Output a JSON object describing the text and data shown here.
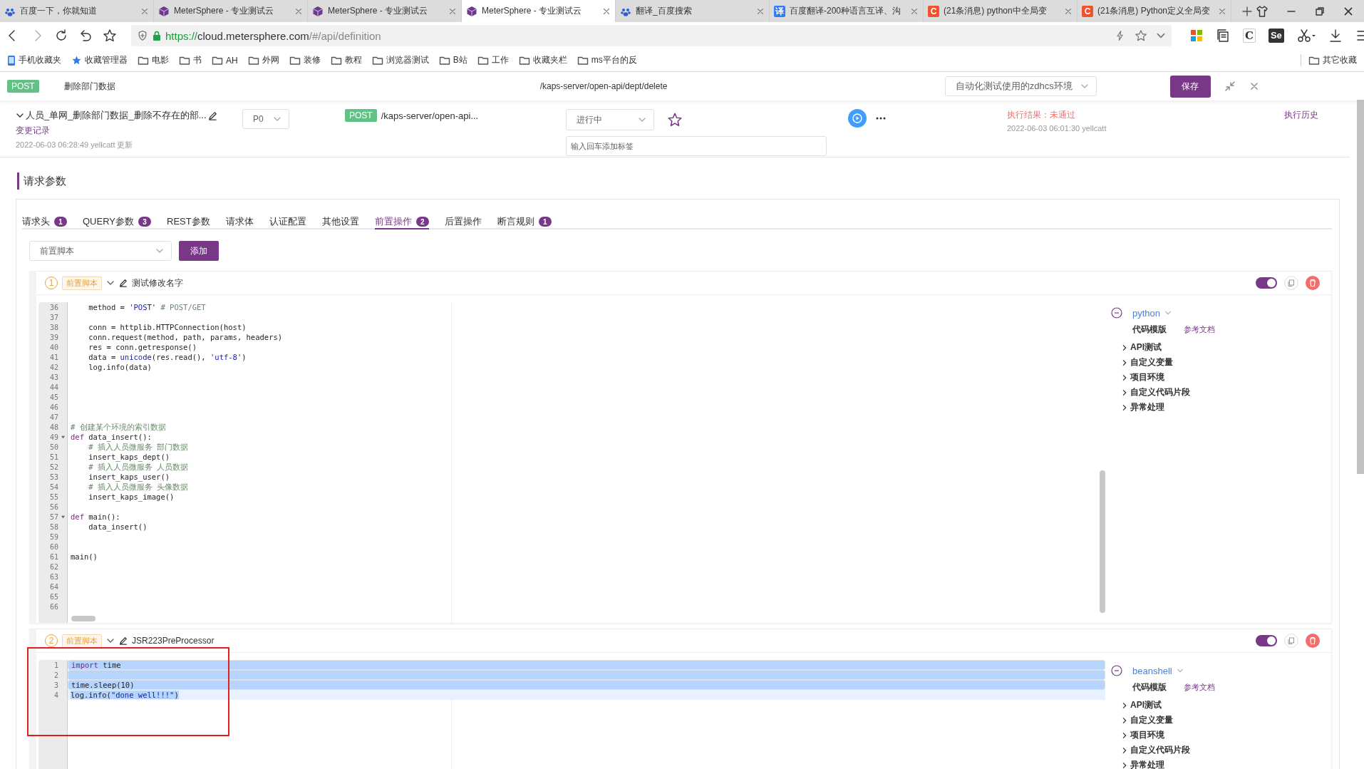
{
  "browser": {
    "tabs": [
      {
        "title": "百度一下，你就知道",
        "kind": "baidu",
        "selected": false
      },
      {
        "title": "MeterSphere - 专业测试云",
        "kind": "metersphere",
        "selected": false
      },
      {
        "title": "MeterSphere - 专业测试云",
        "kind": "metersphere",
        "selected": false
      },
      {
        "title": "MeterSphere - 专业测试云",
        "kind": "metersphere",
        "selected": true
      },
      {
        "title": "翻译_百度搜索",
        "kind": "baidu",
        "selected": false
      },
      {
        "title": "百度翻译-200种语言互译、沟",
        "kind": "badge",
        "badge": "译",
        "color": "#2e7cf6",
        "selected": false
      },
      {
        "title": "(21条消息) python中全局变",
        "kind": "badge",
        "badge": "C",
        "color": "#f0522d",
        "selected": false
      },
      {
        "title": "(21条消息) Python定义全局变",
        "kind": "badge",
        "badge": "C",
        "color": "#f0522d",
        "selected": false
      }
    ],
    "address": {
      "scheme": "https://",
      "host": "cloud.metersphere.com",
      "path": "/#/api/definition"
    },
    "extensions": [
      {
        "kind": "tiles"
      },
      {
        "kind": "reader"
      },
      {
        "kind": "letter",
        "text": "C"
      },
      {
        "kind": "dark-letter",
        "text": "Se"
      },
      {
        "kind": "scissors"
      },
      {
        "kind": "download"
      },
      {
        "kind": "menu"
      }
    ],
    "bookmarks": [
      {
        "label": "手机收藏夹",
        "kind": "phone"
      },
      {
        "label": "收藏管理器",
        "kind": "star"
      },
      {
        "label": "电影",
        "kind": "folder"
      },
      {
        "label": "书",
        "kind": "folder"
      },
      {
        "label": "AH",
        "kind": "folder"
      },
      {
        "label": "外网",
        "kind": "folder"
      },
      {
        "label": "装修",
        "kind": "folder"
      },
      {
        "label": "教程",
        "kind": "folder"
      },
      {
        "label": "浏览器测试",
        "kind": "folder"
      },
      {
        "label": "B站",
        "kind": "folder"
      },
      {
        "label": "工作",
        "kind": "folder"
      },
      {
        "label": "收藏夹栏",
        "kind": "folder"
      },
      {
        "label": "ms平台的反",
        "kind": "folder"
      }
    ],
    "other_bookmarks": "其它收藏"
  },
  "header": {
    "method": "POST",
    "name": "删除部门数据",
    "path": "/kaps-server/open-api/dept/delete",
    "environment": "自动化测试使用的zdhcs环境",
    "save": "保存"
  },
  "case": {
    "name": "人员_单网_删除部门数据_删除不存在的部...",
    "change_log": "变更记录",
    "updated": "2022-06-03 06:28:49 yellcatt 更新",
    "priority": "P0",
    "method": "POST",
    "path": "/kaps-server/open-api...",
    "status": "进行中",
    "tag_placeholder": "输入回车添加标签",
    "result": "执行结果：未通过",
    "result_time": "2022-06-03 06:01:30 yellcatt",
    "history": "执行历史"
  },
  "section_title": "请求参数",
  "param_tabs": [
    {
      "label": "请求头",
      "count": "1",
      "selected": false
    },
    {
      "label": "QUERY参数",
      "count": "3",
      "selected": false
    },
    {
      "label": "REST参数",
      "selected": false
    },
    {
      "label": "请求体",
      "selected": false
    },
    {
      "label": "认证配置",
      "selected": false
    },
    {
      "label": "其他设置",
      "selected": false
    },
    {
      "label": "前置操作",
      "count": "2",
      "selected": true
    },
    {
      "label": "后置操作",
      "selected": false
    },
    {
      "label": "断言规则",
      "count": "1",
      "selected": false
    }
  ],
  "processor_select": "前置脚本",
  "add_button": "添加",
  "processors": [
    {
      "index": "1",
      "type": "前置脚本",
      "name": "测试修改名字",
      "enabled": true,
      "language": "python",
      "template": "代码模版",
      "docs": "参考文档",
      "snippets": [
        "API测试",
        "自定义变量",
        "项目环境",
        "自定义代码片段",
        "异常处理"
      ],
      "lines": [
        {
          "number": "36",
          "fold": false,
          "selected": false,
          "parts": [
            {
              "text": "    method = ",
              "kind": "plain"
            },
            {
              "text": "'POST'",
              "kind": "string"
            },
            {
              "text": " # POST/GET",
              "kind": "comment"
            }
          ]
        },
        {
          "number": "37",
          "fold": false,
          "selected": false
        },
        {
          "number": "38",
          "fold": false,
          "selected": false,
          "parts": [
            {
              "text": "    conn = httplib.HTTPConnection(host)",
              "kind": "plain"
            }
          ]
        },
        {
          "number": "39",
          "fold": false,
          "selected": false,
          "parts": [
            {
              "text": "    conn.request(method, path, params, headers)",
              "kind": "plain"
            }
          ]
        },
        {
          "number": "40",
          "fold": false,
          "selected": false,
          "parts": [
            {
              "text": "    res = conn.getresponse()",
              "kind": "plain"
            }
          ]
        },
        {
          "number": "41",
          "fold": false,
          "selected": false,
          "parts": [
            {
              "text": "    data = ",
              "kind": "plain"
            },
            {
              "text": "unicode",
              "kind": "string"
            },
            {
              "text": "(res.read(), ",
              "kind": "plain"
            },
            {
              "text": "'utf-8'",
              "kind": "string"
            },
            {
              "text": ")",
              "kind": "plain"
            }
          ]
        },
        {
          "number": "42",
          "fold": false,
          "selected": false,
          "parts": [
            {
              "text": "    log.info(data)",
              "kind": "plain"
            }
          ]
        },
        {
          "number": "43",
          "fold": false,
          "selected": false
        },
        {
          "number": "44",
          "fold": false,
          "selected": false
        },
        {
          "number": "45",
          "fold": false,
          "selected": false
        },
        {
          "number": "46",
          "fold": false,
          "selected": false
        },
        {
          "number": "47",
          "fold": false,
          "selected": false
        },
        {
          "number": "48",
          "fold": false,
          "selected": false,
          "parts": [
            {
              "text": "# 创建某个环境的索引数据",
              "kind": "comment"
            }
          ]
        },
        {
          "number": "49",
          "fold": true,
          "selected": false,
          "parts": [
            {
              "text": "def",
              "kind": "keyword"
            },
            {
              "text": " data_insert():",
              "kind": "plain"
            }
          ]
        },
        {
          "number": "50",
          "fold": false,
          "selected": false,
          "parts": [
            {
              "text": "    # 插入人员微服务 部门数据",
              "kind": "comment"
            }
          ]
        },
        {
          "number": "51",
          "fold": false,
          "selected": false,
          "parts": [
            {
              "text": "    insert_kaps_dept()",
              "kind": "plain"
            }
          ]
        },
        {
          "number": "52",
          "fold": false,
          "selected": false,
          "parts": [
            {
              "text": "    # 插入人员微服务 人员数据",
              "kind": "comment"
            }
          ]
        },
        {
          "number": "53",
          "fold": false,
          "selected": false,
          "parts": [
            {
              "text": "    insert_kaps_user()",
              "kind": "plain"
            }
          ]
        },
        {
          "number": "54",
          "fold": false,
          "selected": false,
          "parts": [
            {
              "text": "    # 插入人员微服务 头像数据",
              "kind": "comment"
            }
          ]
        },
        {
          "number": "55",
          "fold": false,
          "selected": false,
          "parts": [
            {
              "text": "    insert_kaps_image()",
              "kind": "plain"
            }
          ]
        },
        {
          "number": "56",
          "fold": false,
          "selected": false
        },
        {
          "number": "57",
          "fold": true,
          "selected": false,
          "parts": [
            {
              "text": "def",
              "kind": "keyword"
            },
            {
              "text": " main():",
              "kind": "plain"
            }
          ]
        },
        {
          "number": "58",
          "fold": false,
          "selected": false,
          "parts": [
            {
              "text": "    data_insert()",
              "kind": "plain"
            }
          ]
        },
        {
          "number": "59",
          "fold": false,
          "selected": false
        },
        {
          "number": "60",
          "fold": false,
          "selected": false
        },
        {
          "number": "61",
          "fold": false,
          "selected": false,
          "parts": [
            {
              "text": "main()",
              "kind": "plain"
            }
          ]
        },
        {
          "number": "62",
          "fold": false,
          "selected": false
        },
        {
          "number": "63",
          "fold": false,
          "selected": false
        },
        {
          "number": "64",
          "fold": false,
          "selected": false
        },
        {
          "number": "65",
          "fold": false,
          "selected": false
        },
        {
          "number": "66",
          "fold": false,
          "selected": false
        }
      ]
    },
    {
      "index": "2",
      "type": "前置脚本",
      "name": "JSR223PreProcessor",
      "enabled": true,
      "language": "beanshell",
      "template": "代码模版",
      "docs": "参考文档",
      "snippets": [
        "API测试",
        "自定义变量",
        "项目环境",
        "自定义代码片段",
        "异常处理"
      ],
      "lines": [
        {
          "number": "1",
          "fold": false,
          "selected": true,
          "parts": [
            {
              "text": "import",
              "kind": "keyword"
            },
            {
              "text": " time",
              "kind": "plain"
            }
          ]
        },
        {
          "number": "2",
          "fold": false,
          "selected": true
        },
        {
          "number": "3",
          "fold": false,
          "selected": true,
          "parts": [
            {
              "text": "time.sleep(10)",
              "kind": "plain"
            }
          ]
        },
        {
          "number": "4",
          "fold": false,
          "selected": true,
          "parts": [
            {
              "text": "log.info(",
              "kind": "plain"
            },
            {
              "text": "\"done well!!!\"",
              "kind": "string"
            },
            {
              "text": ")",
              "kind": "plain"
            }
          ]
        }
      ]
    }
  ]
}
